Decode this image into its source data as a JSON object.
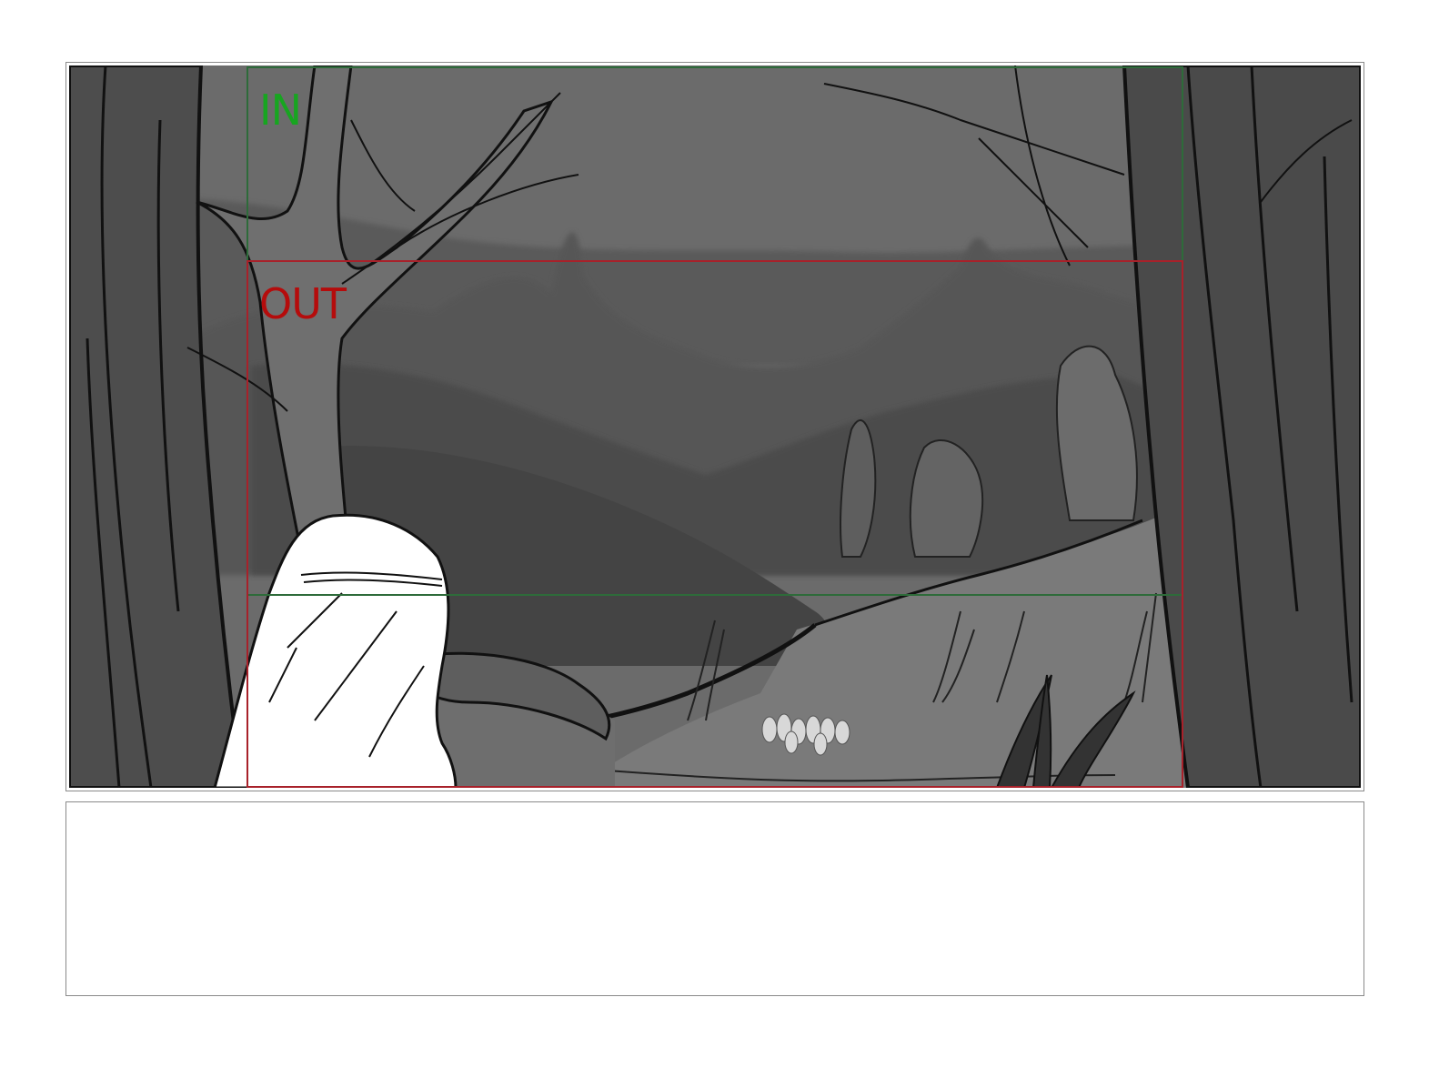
{
  "storyboard": {
    "panel": {
      "image_description_icon": "forest-valley-sketch",
      "camera_in": {
        "label": "IN",
        "color": "#17a520"
      },
      "camera_out": {
        "label": "OUT",
        "color": "#b50c0c"
      }
    },
    "notes": {
      "text": ""
    }
  }
}
